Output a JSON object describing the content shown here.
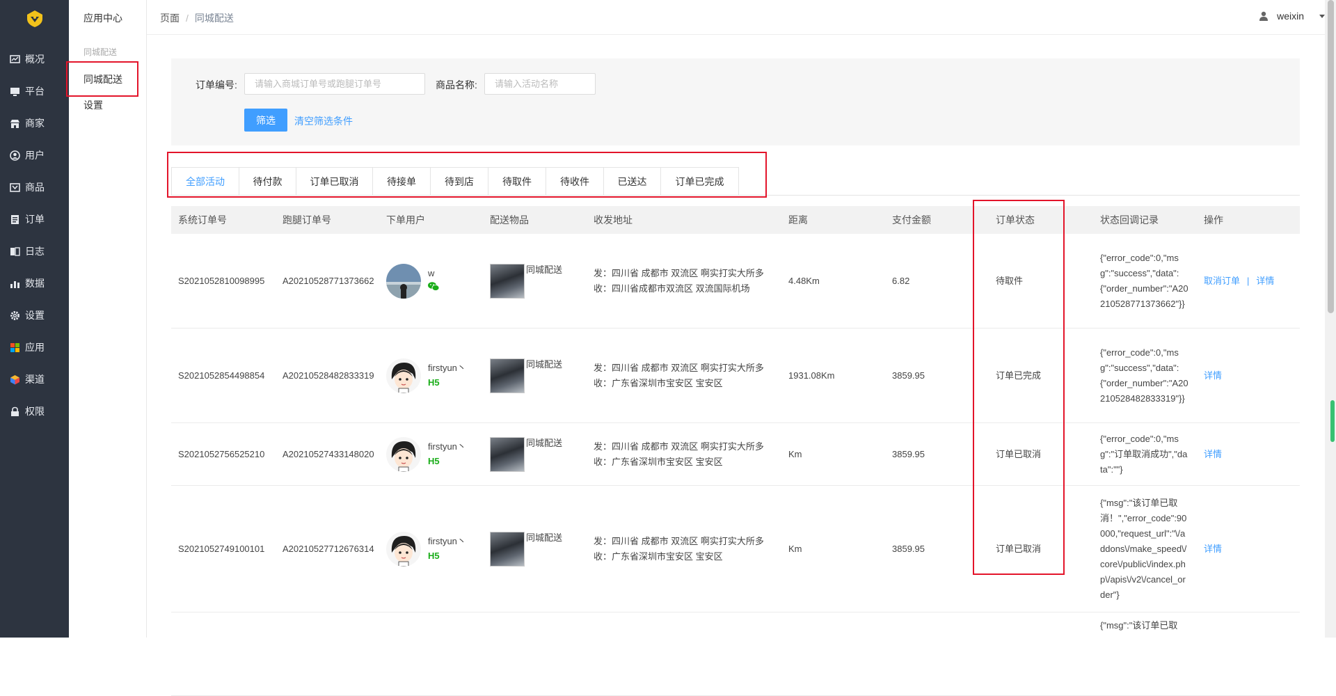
{
  "sidebar": {
    "items": [
      {
        "label": "概况",
        "icon": "chart-icon"
      },
      {
        "label": "平台",
        "icon": "monitor-icon"
      },
      {
        "label": "商家",
        "icon": "store-icon"
      },
      {
        "label": "用户",
        "icon": "user-icon"
      },
      {
        "label": "商品",
        "icon": "goods-icon"
      },
      {
        "label": "订单",
        "icon": "order-icon"
      },
      {
        "label": "日志",
        "icon": "log-icon"
      },
      {
        "label": "数据",
        "icon": "bar-chart-icon"
      },
      {
        "label": "设置",
        "icon": "gear-icon"
      },
      {
        "label": "应用",
        "icon": "apps-icon"
      },
      {
        "label": "渠道",
        "icon": "cube-icon"
      },
      {
        "label": "权限",
        "icon": "lock-icon"
      }
    ]
  },
  "subnav": {
    "title": "应用中心",
    "group": "同城配送",
    "items": [
      {
        "label": "同城配送"
      },
      {
        "label": "设置"
      }
    ]
  },
  "header": {
    "breadcrumb_root": "页面",
    "breadcrumb_sep": "/",
    "breadcrumb_current": "同城配送",
    "username": "weixin"
  },
  "filter": {
    "order_label": "订单编号:",
    "order_placeholder": "请输入商城订单号或跑腿订单号",
    "goods_label": "商品名称:",
    "goods_placeholder": "请输入活动名称",
    "submit_label": "筛选",
    "clear_label": "清空筛选条件"
  },
  "tabs": [
    {
      "label": "全部活动",
      "active": true
    },
    {
      "label": "待付款"
    },
    {
      "label": "订单已取消"
    },
    {
      "label": "待接单"
    },
    {
      "label": "待到店"
    },
    {
      "label": "待取件"
    },
    {
      "label": "待收件"
    },
    {
      "label": "已送达"
    },
    {
      "label": "订单已完成"
    }
  ],
  "table": {
    "headers": [
      "系统订单号",
      "跑腿订单号",
      "下单用户",
      "配送物品",
      "收发地址",
      "距离",
      "支付金额",
      "订单状态",
      "状态回调记录",
      "操作"
    ],
    "rows": [
      {
        "sys_no": "S2021052810098995",
        "run_no": "A20210528771373662",
        "user": "w",
        "user_tag": "wechat",
        "goods": "同城配送",
        "from": "发：四川省 成都市 双流区 啊实打实大所多",
        "to": "收：四川省成都市双流区 双流国际机场",
        "distance": "4.48Km",
        "amount": "6.82",
        "status": "待取件",
        "log": "{\"error_code\":0,\"msg\":\"success\",\"data\":{\"order_number\":\"A20210528771373662\"}}",
        "ops": [
          "取消订单",
          "详情"
        ]
      },
      {
        "sys_no": "S2021052854498854",
        "run_no": "A20210528482833319",
        "user": "firstyun丶",
        "user_tag": "H5",
        "goods": "同城配送",
        "from": "发：四川省 成都市 双流区 啊实打实大所多",
        "to": "收：广东省深圳市宝安区 宝安区",
        "distance": "1931.08Km",
        "amount": "3859.95",
        "status": "订单已完成",
        "log": "{\"error_code\":0,\"msg\":\"success\",\"data\":{\"order_number\":\"A20210528482833319\"}}",
        "ops": [
          "详情"
        ]
      },
      {
        "sys_no": "S2021052756525210",
        "run_no": "A20210527433148020",
        "user": "firstyun丶",
        "user_tag": "H5",
        "goods": "同城配送",
        "from": "发：四川省 成都市 双流区 啊实打实大所多",
        "to": "收：广东省深圳市宝安区 宝安区",
        "distance": "Km",
        "amount": "3859.95",
        "status": "订单已取消",
        "log": "{\"error_code\":0,\"msg\":\"订单取消成功\",\"data\":\"\"}",
        "ops": [
          "详情"
        ]
      },
      {
        "sys_no": "S2021052749100101",
        "run_no": "A20210527712676314",
        "user": "firstyun丶",
        "user_tag": "H5",
        "goods": "同城配送",
        "from": "发：四川省 成都市 双流区 啊实打实大所多",
        "to": "收：广东省深圳市宝安区 宝安区",
        "distance": "Km",
        "amount": "3859.95",
        "status": "订单已取消",
        "log": "{\"msg\":\"该订单已取消！\",\"error_code\":90000,\"request_url\":\"\\/addons\\/make_speed\\/core\\/public\\/index.php\\/apis\\/v2\\/cancel_order\"}",
        "ops": [
          "详情"
        ]
      },
      {
        "sys_no": "",
        "run_no": "",
        "user": "",
        "user_tag": "",
        "goods": "",
        "from": "",
        "to": "",
        "distance": "",
        "amount": "",
        "status": "",
        "log": "{\"msg\":\"该订单已取",
        "ops": []
      }
    ]
  },
  "colors": {
    "sidebar_bg": "#2d3440",
    "accent": "#409eff",
    "highlight_border": "#e3142a",
    "h5_badge": "#1aad19"
  }
}
